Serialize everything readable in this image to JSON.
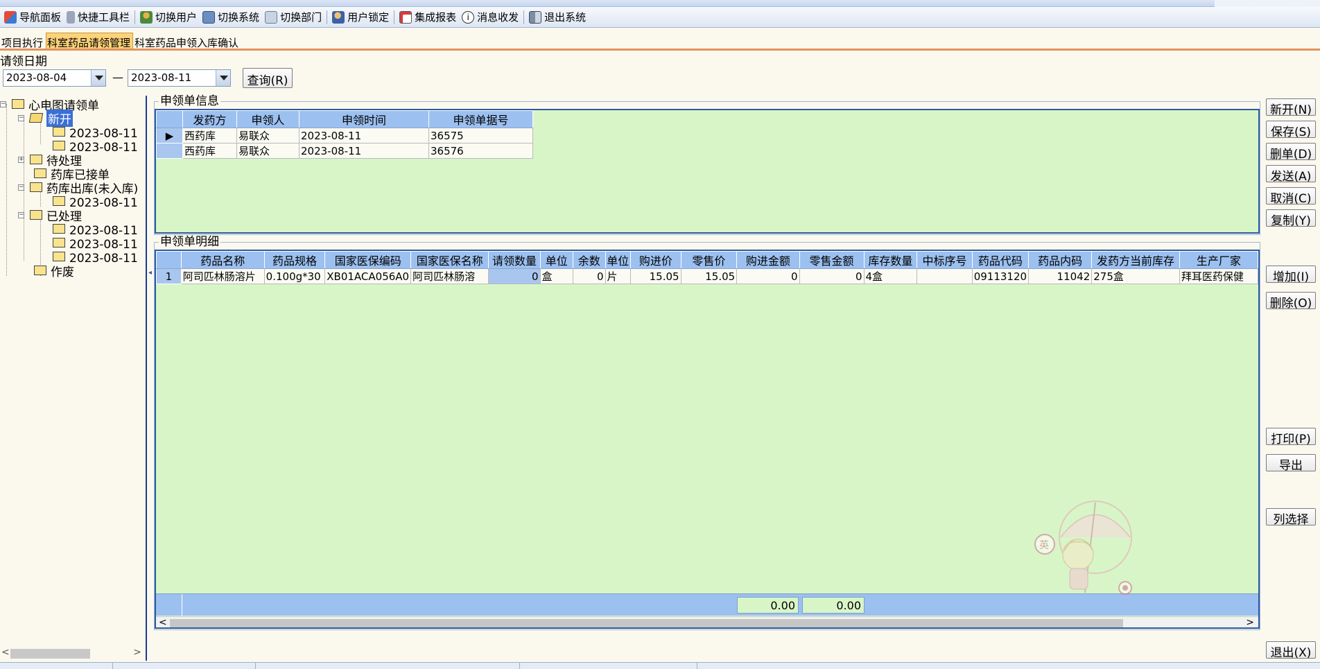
{
  "toolbar": {
    "items": [
      {
        "label": "导航面板",
        "icon": "navigation-panel-icon"
      },
      {
        "label": "快捷工具栏",
        "icon": "quick-toolbar-icon"
      },
      {
        "label": "切换用户",
        "icon": "switch-user-icon"
      },
      {
        "label": "切换系统",
        "icon": "switch-system-icon"
      },
      {
        "label": "切换部门",
        "icon": "switch-department-icon"
      },
      {
        "label": "用户锁定",
        "icon": "user-lock-icon"
      },
      {
        "label": "集成报表",
        "icon": "integrated-report-icon"
      },
      {
        "label": "消息收发",
        "icon": "message-icon"
      },
      {
        "label": "退出系统",
        "icon": "exit-system-icon"
      }
    ]
  },
  "tabs": [
    {
      "label": "项目执行",
      "active": false
    },
    {
      "label": "科室药品请领管理",
      "active": true
    },
    {
      "label": "科室药品申领入库确认",
      "active": false
    }
  ],
  "filter": {
    "label": "请领日期",
    "date_from": "2023-08-04",
    "separator": "—",
    "date_to": "2023-08-11",
    "query_button": "查询(R)"
  },
  "tree": {
    "root": "心电图请领单",
    "nodes": {
      "new": "新开",
      "new_item_1": "2023-08-11【3",
      "new_item_2": "2023-08-11【3",
      "pending": "待处理",
      "received": "药库已接单",
      "outbound": "药库出库(未入库)",
      "outbound_item_1": "2023-08-11【3",
      "processed": "已处理",
      "processed_item_1": "2023-08-11【3",
      "processed_item_2": "2023-08-11【3",
      "processed_item_3": "2023-08-11【3",
      "void": "作废"
    }
  },
  "requisition_info": {
    "title": "申领单信息",
    "columns": [
      "发药方",
      "申领人",
      "申领时间",
      "申领单据号"
    ],
    "rows": [
      [
        "西药库",
        "易联众",
        "2023-08-11",
        "36575"
      ],
      [
        "西药库",
        "易联众",
        "2023-08-11",
        "36576"
      ]
    ]
  },
  "requisition_detail": {
    "title": "申领单明细",
    "columns": [
      "药品名称",
      "药品规格",
      "国家医保编码",
      "国家医保名称",
      "请领数量",
      "单位",
      "余数",
      "单位",
      "购进价",
      "零售价",
      "购进金额",
      "零售金额",
      "库存数量",
      "中标序号",
      "药品代码",
      "药品内码",
      "发药方当前库存",
      "生产厂家"
    ],
    "rows": [
      [
        "1",
        "阿司匹林肠溶片",
        "0.100g*30",
        "XB01ACA056A0",
        "阿司匹林肠溶",
        "0",
        "盒",
        "0",
        "片",
        "15.05",
        "15.05",
        "0",
        "0",
        "4盒",
        "",
        "09113120",
        "11042",
        "275盒",
        "拜耳医药保健"
      ]
    ],
    "footer_totals": [
      "0.00",
      "0.00"
    ]
  },
  "right_buttons": {
    "new": "新开(N)",
    "save": "保存(S)",
    "delete_doc": "删单(D)",
    "send": "发送(A)",
    "cancel": "取消(C)",
    "copy": "复制(Y)",
    "add": "增加(I)",
    "delete": "删除(O)",
    "print": "打印(P)",
    "export": "导出",
    "column_select": "列选择",
    "exit": "退出(X)"
  },
  "mascot_text": "英"
}
